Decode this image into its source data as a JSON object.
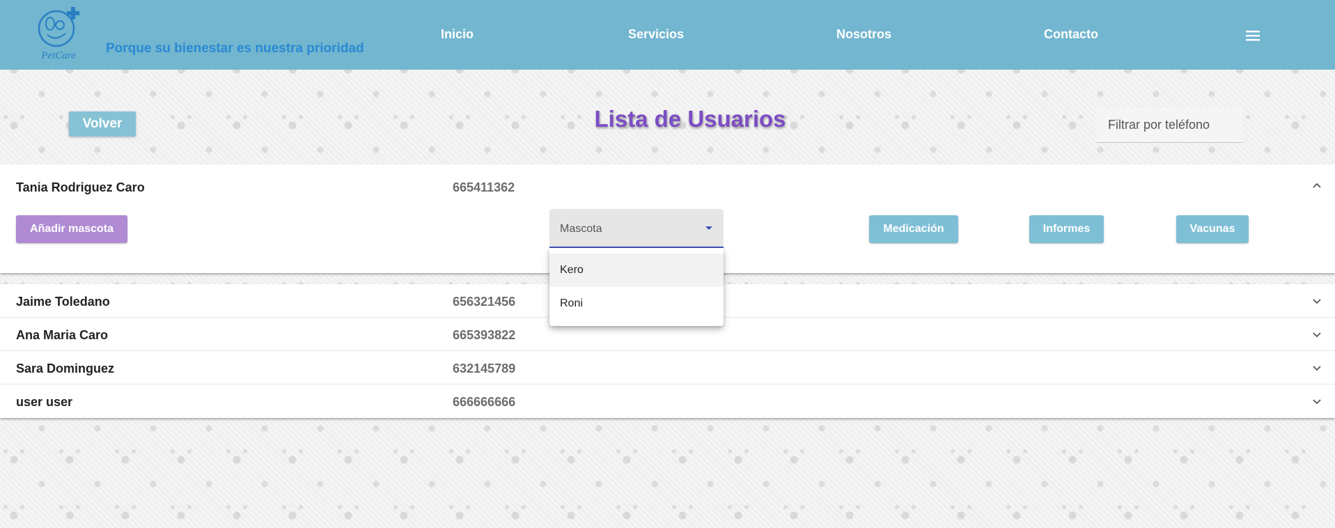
{
  "header": {
    "brand": "PetCare",
    "tagline": "Porque su bienestar es nuestra prioridad",
    "nav": [
      {
        "label": "Inicio"
      },
      {
        "label": "Servicios"
      },
      {
        "label": "Nosotros"
      },
      {
        "label": "Contacto"
      }
    ],
    "menu_icon": "hamburger-menu-icon"
  },
  "toolbar": {
    "back_label": "Volver",
    "title": "Lista de Usuarios",
    "filter_placeholder": "Filtrar por teléfono"
  },
  "expanded_user": {
    "name": "Tania Rodriguez Caro",
    "phone": "665411362",
    "add_pet_label": "Añadir mascota",
    "pet_select": {
      "label": "Mascota",
      "options": [
        "Kero",
        "Roni"
      ]
    },
    "actions": [
      "Medicación",
      "Informes",
      "Vacunas"
    ]
  },
  "users": [
    {
      "name": "Jaime Toledano",
      "phone": "656321456"
    },
    {
      "name": "Ana Maria Caro",
      "phone": "665393822"
    },
    {
      "name": "Sara Dominguez",
      "phone": "632145789"
    },
    {
      "name": "user user",
      "phone": "666666666"
    }
  ],
  "colors": {
    "header_bg": "#72b6cf",
    "title": "#7c4dc4",
    "tagline": "#2a89d4",
    "add_button": "#b08bd4",
    "action_button": "#7fbfd6",
    "select_underline": "#3f51b5"
  }
}
